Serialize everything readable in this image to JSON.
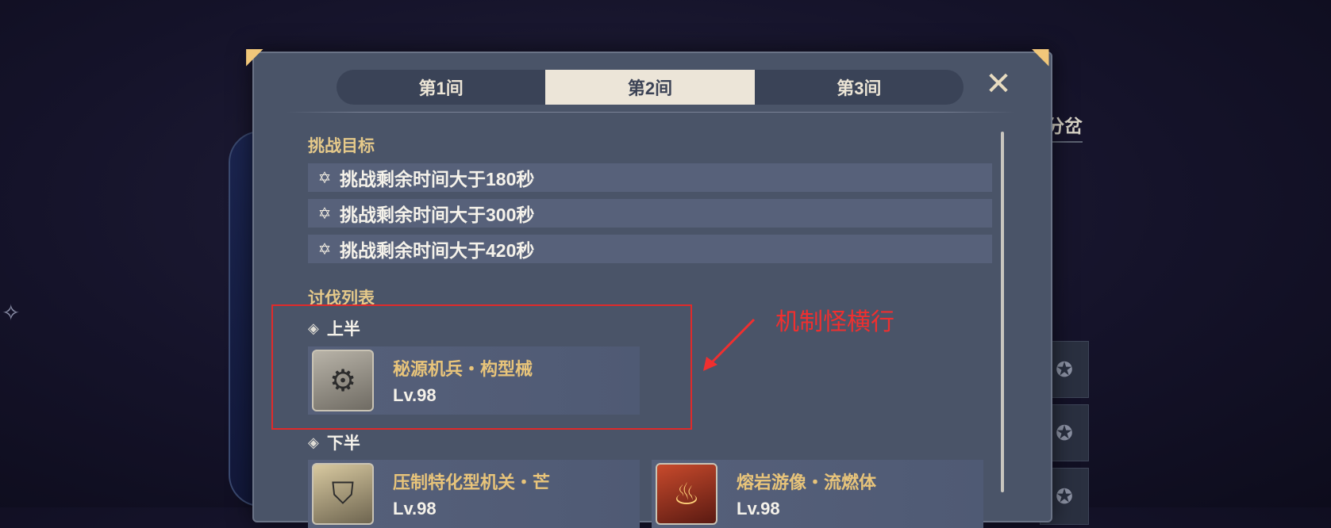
{
  "tabs": [
    {
      "label": "第1间",
      "active": false
    },
    {
      "label": "第2间",
      "active": true
    },
    {
      "label": "第3间",
      "active": false
    }
  ],
  "close_label": "✕",
  "background": {
    "right_text": "分岔",
    "left_glyph": "✧",
    "slot_icon": "✪"
  },
  "goals": {
    "title": "挑战目标",
    "icon": "✡",
    "items": [
      "挑战剩余时间大于180秒",
      "挑战剩余时间大于300秒",
      "挑战剩余时间大于420秒"
    ]
  },
  "enemies": {
    "title": "讨伐列表",
    "upper": {
      "label": "上半",
      "list": [
        {
          "name": "秘源机兵・构型械",
          "level": "Lv.98",
          "icon": "robot-icon"
        }
      ]
    },
    "lower": {
      "label": "下半",
      "list": [
        {
          "name": "压制特化型机关・芒",
          "level": "Lv.98",
          "icon": "mech-icon"
        },
        {
          "name": "熔岩游像・流燃体",
          "level": "Lv.98",
          "icon": "lava-icon"
        }
      ]
    }
  },
  "annotation": {
    "text": "机制怪横行",
    "color": "#f02f2f"
  },
  "colors": {
    "panel": "#4a5468",
    "gold": "#e5c98a",
    "tab_active": "#ece5d8"
  }
}
